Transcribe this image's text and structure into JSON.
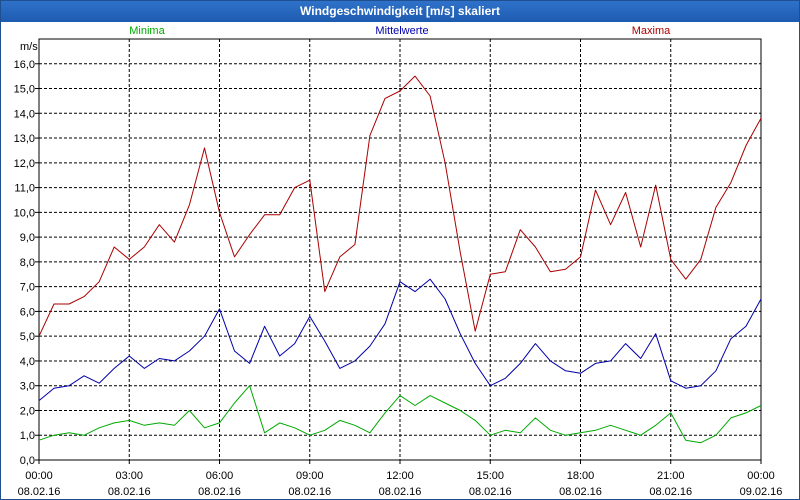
{
  "window": {
    "title": "Windgeschwindigkeit [m/s] skaliert"
  },
  "colors": {
    "minima": "#00aa00",
    "mittelwerte": "#0000aa",
    "maxima": "#aa0000",
    "grid": "#000000",
    "title_bar": "#2466bd"
  },
  "chart_data": {
    "type": "line",
    "ylabel": "m/s",
    "ylim": [
      0,
      17
    ],
    "yticks": [
      "0,0",
      "1,0",
      "2,0",
      "3,0",
      "4,0",
      "5,0",
      "6,0",
      "7,0",
      "8,0",
      "9,0",
      "10,0",
      "11,0",
      "12,0",
      "13,0",
      "14,0",
      "15,0",
      "16,0"
    ],
    "xlim_hours": [
      0,
      24
    ],
    "xticks": [
      {
        "time": "00:00",
        "date": "08.02.16"
      },
      {
        "time": "03:00",
        "date": "08.02.16"
      },
      {
        "time": "06:00",
        "date": "08.02.16"
      },
      {
        "time": "09:00",
        "date": "08.02.16"
      },
      {
        "time": "12:00",
        "date": "08.02.16"
      },
      {
        "time": "15:00",
        "date": "08.02.16"
      },
      {
        "time": "18:00",
        "date": "08.02.16"
      },
      {
        "time": "21:00",
        "date": "08.02.16"
      },
      {
        "time": "00:00",
        "date": "09.02.16"
      }
    ],
    "grid": true,
    "legend_placement": "top",
    "x_hours": [
      0,
      0.5,
      1,
      1.5,
      2,
      2.5,
      3,
      3.5,
      4,
      4.5,
      5,
      5.5,
      6,
      6.5,
      7,
      7.5,
      8,
      8.5,
      9,
      9.5,
      10,
      10.5,
      11,
      11.5,
      12,
      12.5,
      13,
      13.5,
      14,
      14.5,
      15,
      15.5,
      16,
      16.5,
      17,
      17.5,
      18,
      18.5,
      19,
      19.5,
      20,
      20.5,
      21,
      21.5,
      22,
      22.5,
      23,
      23.5,
      24
    ],
    "series": [
      {
        "name": "Minima",
        "color_key": "minima",
        "values": [
          0.8,
          1.0,
          1.1,
          1.0,
          1.3,
          1.5,
          1.6,
          1.4,
          1.5,
          1.4,
          2.0,
          1.3,
          1.5,
          2.3,
          3.0,
          1.1,
          1.5,
          1.3,
          1.0,
          1.2,
          1.6,
          1.4,
          1.1,
          1.9,
          2.6,
          2.2,
          2.6,
          2.3,
          2.0,
          1.6,
          1.0,
          1.2,
          1.1,
          1.7,
          1.2,
          1.0,
          1.1,
          1.2,
          1.4,
          1.2,
          1.0,
          1.4,
          1.9,
          0.8,
          0.7,
          1.0,
          1.7,
          1.9,
          2.2
        ]
      },
      {
        "name": "Mittelwerte",
        "color_key": "mittelwerte",
        "values": [
          2.4,
          2.9,
          3.0,
          3.4,
          3.1,
          3.7,
          4.2,
          3.7,
          4.1,
          4.0,
          4.4,
          5.0,
          6.1,
          4.4,
          3.9,
          5.4,
          4.2,
          4.7,
          5.8,
          4.8,
          3.7,
          4.0,
          4.6,
          5.5,
          7.2,
          6.8,
          7.3,
          6.5,
          5.1,
          3.9,
          3.0,
          3.3,
          3.9,
          4.7,
          4.0,
          3.6,
          3.5,
          3.9,
          4.0,
          4.7,
          4.1,
          5.1,
          3.2,
          2.9,
          3.0,
          3.6,
          4.9,
          5.4,
          6.5
        ]
      },
      {
        "name": "Maxima",
        "color_key": "maxima",
        "values": [
          5.0,
          6.3,
          6.3,
          6.6,
          7.2,
          8.6,
          8.1,
          8.6,
          9.5,
          8.8,
          10.3,
          12.6,
          10.0,
          8.2,
          9.1,
          9.9,
          9.9,
          11.0,
          11.3,
          6.8,
          8.2,
          8.7,
          13.1,
          14.6,
          14.9,
          15.5,
          14.7,
          12.0,
          8.4,
          5.2,
          7.5,
          7.6,
          9.3,
          8.6,
          7.6,
          7.7,
          8.2,
          10.9,
          9.5,
          10.8,
          8.6,
          11.1,
          8.1,
          7.3,
          8.1,
          10.2,
          11.2,
          12.7,
          13.8
        ]
      }
    ]
  }
}
